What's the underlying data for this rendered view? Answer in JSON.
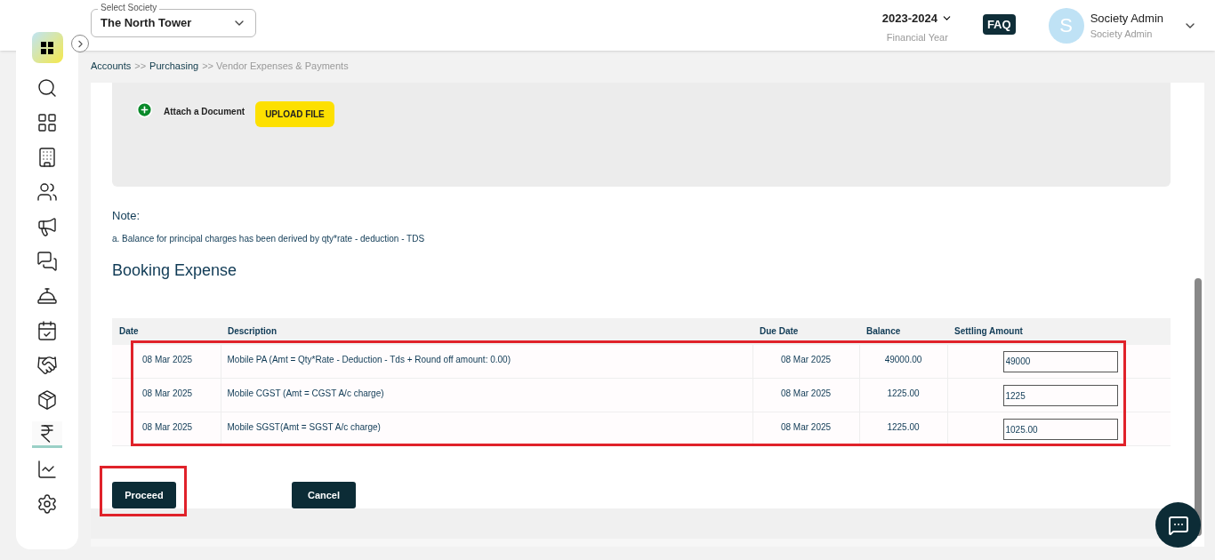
{
  "header": {
    "society_label": "Select Society",
    "society": "The North Tower",
    "year": "2023-2024",
    "year_label": "Financial Year",
    "faq": "FAQ",
    "avatar_letter": "S",
    "user_name": "Society Admin",
    "user_role": "Society Admin"
  },
  "sidebar": {
    "items": [
      {
        "kind": "search",
        "selected": false
      },
      {
        "kind": "dashboard",
        "selected": false
      },
      {
        "kind": "building",
        "selected": false
      },
      {
        "kind": "people",
        "selected": false
      },
      {
        "kind": "megaphone",
        "selected": false
      },
      {
        "kind": "chat",
        "selected": false
      },
      {
        "kind": "desk",
        "selected": false
      },
      {
        "kind": "calendar",
        "selected": false
      },
      {
        "kind": "handshake",
        "selected": false
      },
      {
        "kind": "box",
        "selected": false
      },
      {
        "kind": "rupee",
        "selected": true
      },
      {
        "kind": "report",
        "selected": false
      },
      {
        "kind": "settings",
        "selected": false
      }
    ]
  },
  "breadcrumb": [
    {
      "label": "Accounts",
      "link": true
    },
    {
      "label": ">>",
      "link": false
    },
    {
      "label": "Purchasing",
      "link": true
    },
    {
      "label": ">> Vendor Expenses & Payments",
      "link": false
    }
  ],
  "attach": {
    "label": "Attach a Document",
    "button": "UPLOAD FILE"
  },
  "note": {
    "title": "Note:",
    "text": "a. Balance for principal charges has been derived by qty*rate - deduction - TDS"
  },
  "section_title": "Booking Expense",
  "table": {
    "columns": [
      "Date",
      "Description",
      "Due Date",
      "Balance",
      "Settling Amount"
    ],
    "rows": [
      {
        "date": "08 Mar 2025",
        "description": "Mobile PA (Amt = Qty*Rate - Deduction - Tds + Round off amount: 0.00)",
        "due_date": "08 Mar 2025",
        "balance": "49000.00",
        "settling": "49000"
      },
      {
        "date": "08 Mar 2025",
        "description": "Mobile CGST (Amt = CGST A/c charge)",
        "due_date": "08 Mar 2025",
        "balance": "1225.00",
        "settling": "1225"
      },
      {
        "date": "08 Mar 2025",
        "description": "Mobile SGST(Amt = SGST A/c charge)",
        "due_date": "08 Mar 2025",
        "balance": "1225.00",
        "settling": "1025.00"
      }
    ]
  },
  "buttons": [
    "Proceed",
    "Cancel"
  ]
}
